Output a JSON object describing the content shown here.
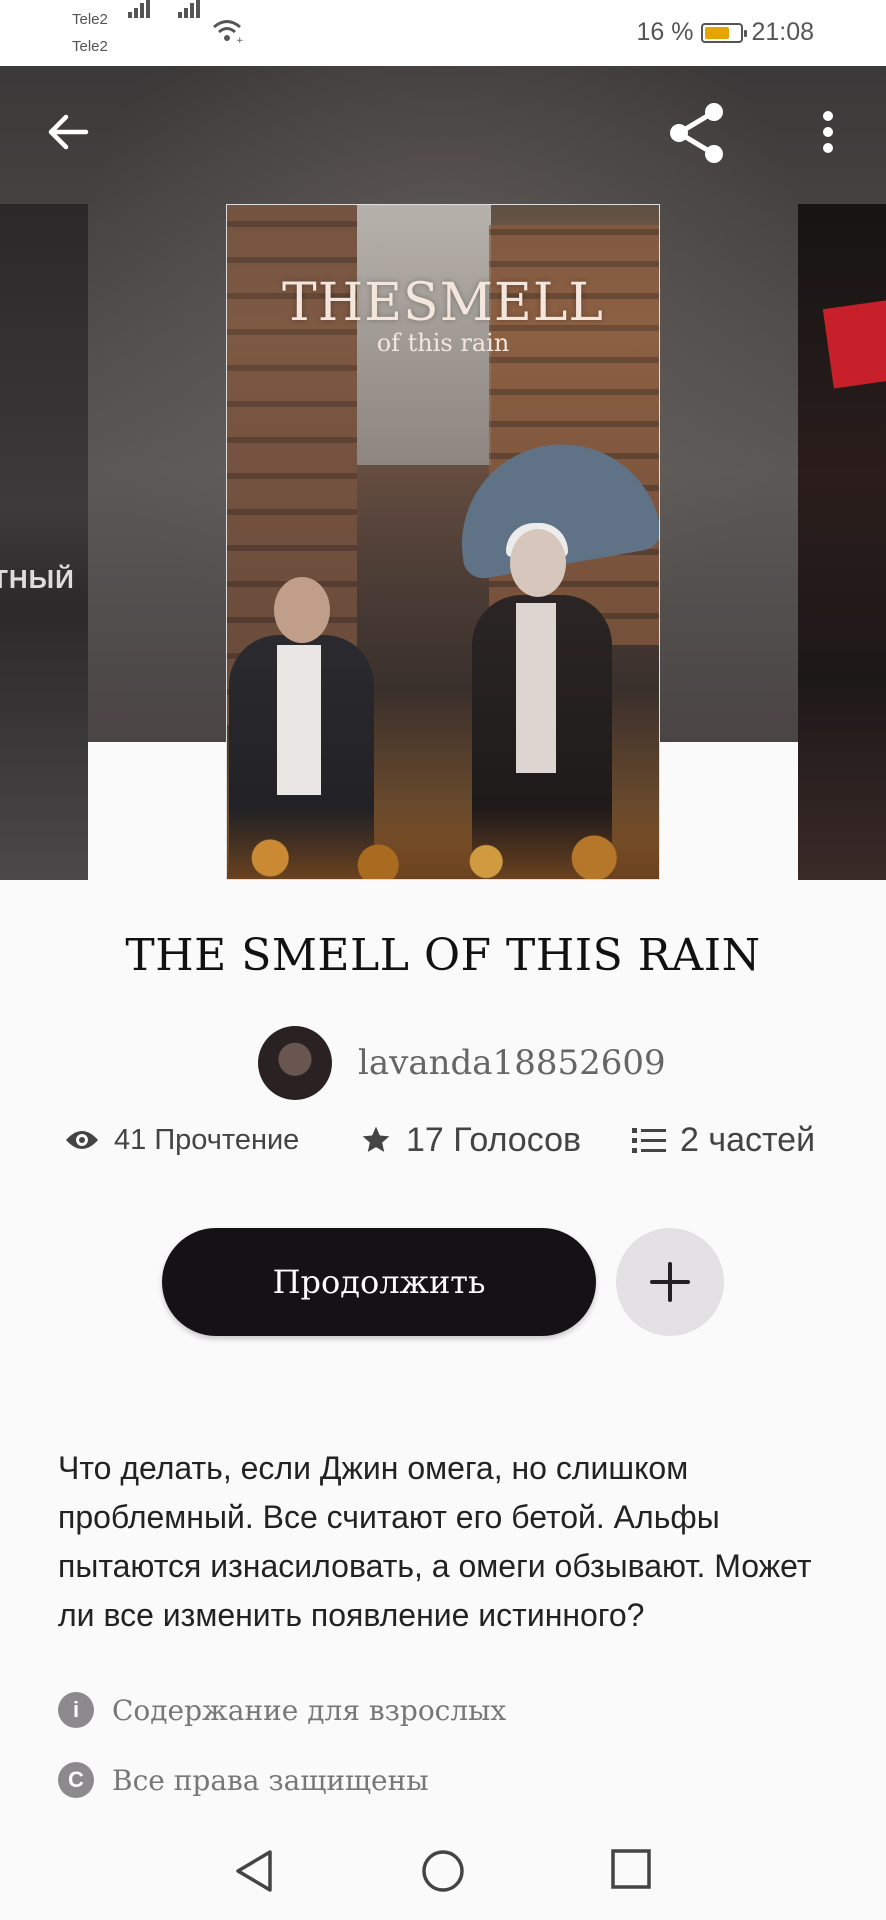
{
  "status_bar": {
    "carrier1": "Tele2",
    "carrier2": "Tele2",
    "battery": "16 %",
    "time": "21:08"
  },
  "toolbar": {
    "back_icon": "arrow-left-icon",
    "share_icon": "share-icon",
    "more_icon": "more-vertical-icon"
  },
  "covers": {
    "left_partial_text": "ТНЫЙ",
    "main_title_art": "THESMELL",
    "main_subtitle_art": "of this rain"
  },
  "book": {
    "title": "THE SMELL OF THIS RAIN",
    "author": "lavanda18852609",
    "stats": {
      "reads": "41 Прочтение",
      "votes": "17 Голосов",
      "parts": "2 частей"
    },
    "continue_label": "Продолжить",
    "description": "Что делать, если Джин омега, но слишком проблемный. Все считают его бетой. Альфы пытаются изнасиловать, а омеги обзывают. Может ли все изменить появление истинного?",
    "mature": "Содержание для взрослых",
    "rights": "Все права защищены"
  },
  "colors": {
    "primary_button": "#141214",
    "secondary_button": "#e3e1e3",
    "battery_fill": "#e6a400"
  }
}
